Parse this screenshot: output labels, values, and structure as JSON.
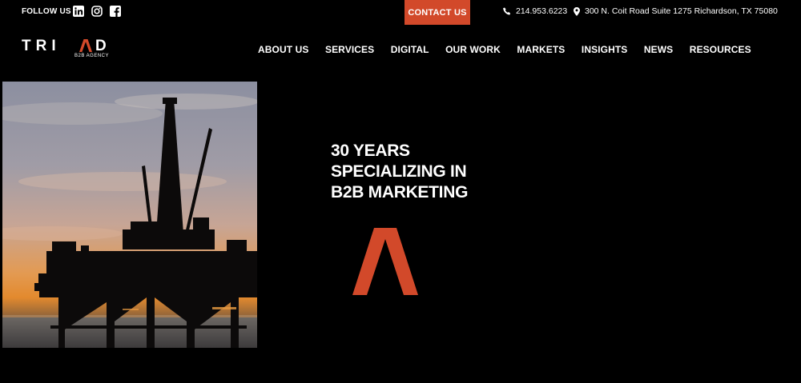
{
  "topbar": {
    "follow_label": "FOLLOW US",
    "social": [
      {
        "name": "linkedin-icon"
      },
      {
        "name": "instagram-icon"
      },
      {
        "name": "facebook-icon"
      }
    ],
    "contact_label": "CONTACT US",
    "phone": "214.953.6223",
    "address": "300 N. Coit Road Suite 1275 Richardson, TX 75080"
  },
  "logo": {
    "word_left": "TRI",
    "word_right": "D",
    "sub": "B2B AGENCY"
  },
  "nav": {
    "items": [
      "ABOUT US",
      "SERVICES",
      "DIGITAL",
      "OUR WORK",
      "MARKETS",
      "INSIGHTS",
      "NEWS",
      "RESOURCES"
    ]
  },
  "hero": {
    "line1": "30 YEARS",
    "line2": "SPECIALIZING IN",
    "line3": "B2B MARKETING"
  },
  "colors": {
    "accent": "#d2492a",
    "background": "#000000"
  }
}
